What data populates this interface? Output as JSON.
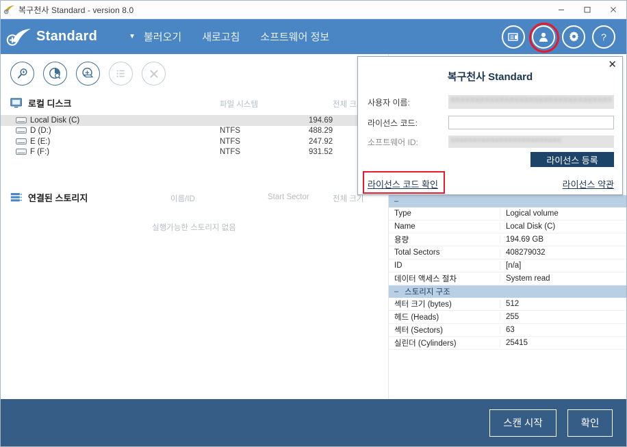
{
  "window": {
    "title": "복구천사 Standard - version 8.0",
    "app_icon": "wing-logo-icon",
    "controls": {
      "minimize": "minimize-icon",
      "maximize": "maximize-icon",
      "close": "close-icon"
    }
  },
  "header": {
    "brand": "Standard",
    "caret": "▼",
    "menu": [
      "불러오기",
      "새로고침",
      "소프트웨어 정보"
    ],
    "icons": [
      {
        "name": "window-list-icon",
        "highlighted": false
      },
      {
        "name": "user-account-icon",
        "highlighted": true
      },
      {
        "name": "settings-gear-icon",
        "highlighted": false
      },
      {
        "name": "help-question-icon",
        "highlighted": false
      }
    ]
  },
  "toolbar": {
    "buttons": [
      {
        "name": "search-icon",
        "disabled": false
      },
      {
        "name": "disk-analyze-icon",
        "disabled": false
      },
      {
        "name": "scan-storage-icon",
        "disabled": false
      },
      {
        "name": "list-view-icon",
        "disabled": true
      },
      {
        "name": "close-x-icon",
        "disabled": true
      }
    ]
  },
  "explorer": {
    "groups": [
      {
        "title": "로컬 디스크",
        "icon": "monitor-icon",
        "columns": [
          "파일 시스템",
          "전체 크기"
        ],
        "rows": [
          {
            "icon": "drive-icon",
            "name": "Local Disk (C)",
            "fs": "",
            "size": "194.69",
            "selected": true
          },
          {
            "icon": "drive-icon",
            "name": "D (D:)",
            "fs": "NTFS",
            "size": "488.29",
            "selected": false
          },
          {
            "icon": "drive-icon",
            "name": "E (E:)",
            "fs": "NTFS",
            "size": "247.92",
            "selected": false
          },
          {
            "icon": "drive-icon",
            "name": "F (F:)",
            "fs": "NTFS",
            "size": "931.52",
            "selected": false
          }
        ]
      },
      {
        "title": "연결된 스토리지",
        "icon": "storage-stack-icon",
        "columns": [
          "이름/ID",
          "Start Sector",
          "전체 크기"
        ],
        "rows": [],
        "empty_text": "실행가능한 스토리지 없음"
      }
    ]
  },
  "properties": {
    "sections": [
      {
        "header": "",
        "rows": [
          {
            "key": "Type",
            "value": "Logical volume"
          },
          {
            "key": "Name",
            "value": "Local Disk (C)"
          },
          {
            "key": "용량",
            "value": "194.69 GB"
          },
          {
            "key": "Total Sectors",
            "value": "408279032"
          },
          {
            "key": "ID",
            "value": "[n/a]"
          },
          {
            "key": "데이터 액세스 절차",
            "value": "System read"
          }
        ]
      },
      {
        "header": "스토리지 구조",
        "collapse_glyph": "–",
        "rows": [
          {
            "key": "섹터 크기 (bytes)",
            "value": "512"
          },
          {
            "key": "헤드 (Heads)",
            "value": "255"
          },
          {
            "key": "섹터 (Sectors)",
            "value": "63"
          },
          {
            "key": "실린더 (Cylinders)",
            "value": "25415"
          }
        ]
      }
    ]
  },
  "bottom_bar": {
    "scan_label": "스캔 시작",
    "ok_label": "확인"
  },
  "license_dialog": {
    "close_glyph": "✕",
    "title": "복구천사 Standard",
    "fields": [
      {
        "label": "사용자 이름:",
        "value": "XXXXXXXXXXXXXXXXXXXXXXXXXXXXXXXXXXXXXXX",
        "redacted": true,
        "dim": false
      },
      {
        "label": "라이선스 코드:",
        "value": "",
        "redacted": false,
        "dim": false
      },
      {
        "label": "소프트웨어 ID:",
        "value": "XXXXXXXXXXXXXXXXXXXXXXXXX",
        "redacted": true,
        "dim": true
      }
    ],
    "register_button": "라이선스 등록",
    "verify_link": "라이선스 코드 확인",
    "terms_link": "라이선스 약관"
  },
  "colors": {
    "header_blue": "#4a86c4",
    "bottom_blue": "#355d85",
    "register_navy": "#1c4368",
    "highlight_red": "#e8192c",
    "prop_section_blue": "#b9cfe4",
    "selection_grey": "#e4e4e4"
  }
}
